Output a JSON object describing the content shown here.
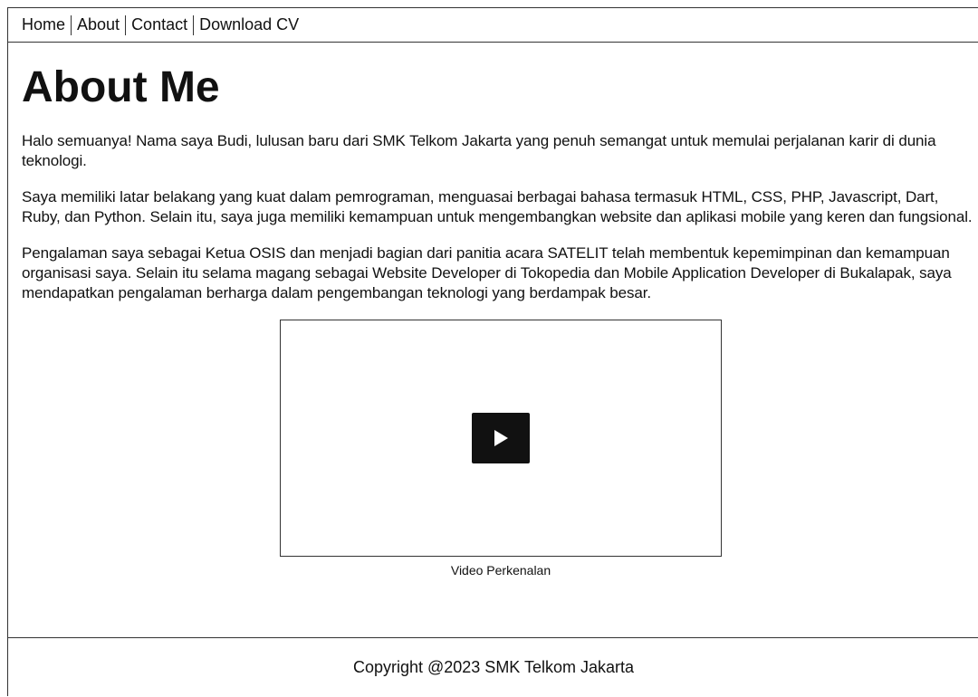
{
  "nav": {
    "items": [
      {
        "label": "Home"
      },
      {
        "label": "About"
      },
      {
        "label": "Contact"
      },
      {
        "label": "Download CV"
      }
    ]
  },
  "main": {
    "title": "About Me",
    "paragraphs": [
      "Halo semuanya! Nama saya Budi, lulusan baru dari SMK Telkom Jakarta yang penuh semangat untuk memulai perjalanan karir di dunia teknologi.",
      "Saya memiliki latar belakang yang kuat dalam pemrograman, menguasai berbagai bahasa termasuk HTML, CSS, PHP, Javascript, Dart, Ruby, dan Python. Selain itu, saya juga memiliki kemampuan untuk mengembangkan website dan aplikasi mobile yang keren dan fungsional.",
      "Pengalaman saya sebagai Ketua OSIS dan menjadi bagian dari panitia acara SATELIT telah membentuk kepemimpinan dan kemampuan organisasi saya. Selain itu selama magang sebagai Website Developer di Tokopedia dan Mobile Application Developer di Bukalapak, saya mendapatkan pengalaman berharga dalam pengembangan teknologi yang berdampak besar."
    ],
    "video": {
      "caption": "Video Perkenalan",
      "play_icon": "play-icon"
    }
  },
  "footer": {
    "text": "Copyright @2023 SMK Telkom Jakarta"
  }
}
